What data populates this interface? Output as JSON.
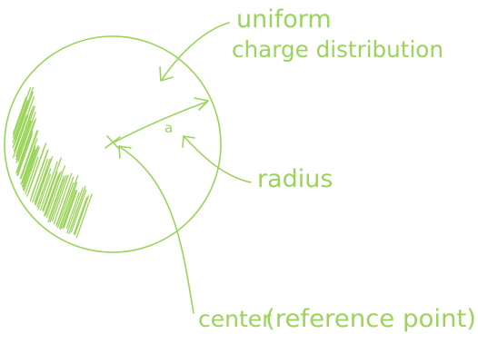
{
  "diagram": {
    "ink_color": "#9bd45a",
    "labels": {
      "charge_line1": "uniform",
      "charge_line2": "charge distribution",
      "radius_symbol": "a",
      "radius": "radius",
      "center": "center",
      "reference": "(reference point)"
    }
  }
}
